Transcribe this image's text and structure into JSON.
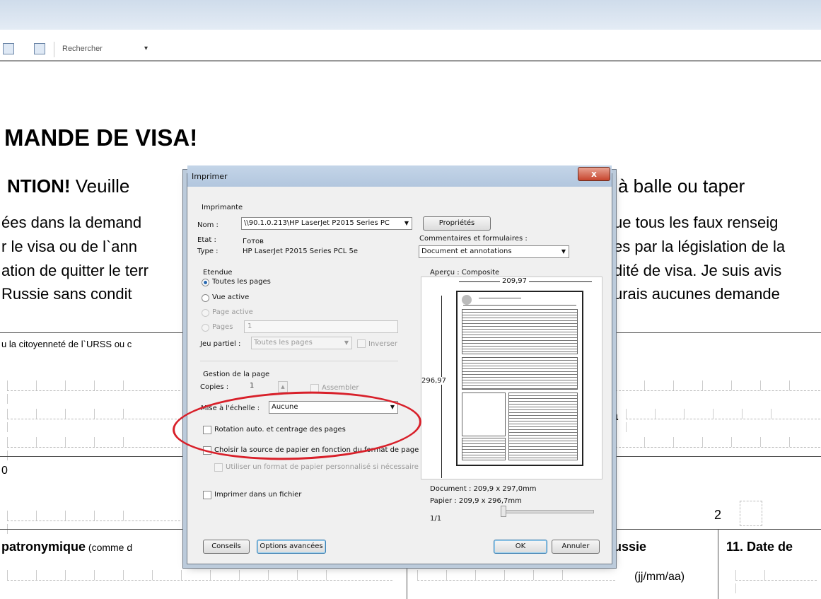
{
  "toolbar": {
    "search_label": "Rechercher"
  },
  "document": {
    "title": "MANDE DE VISA!",
    "attention_bold": "NTION!",
    "attention_rest": " Veuille",
    "attention_right": "à balle ou taper",
    "left_lines": [
      "ées dans la demand",
      "r le visa ou de l`ann",
      "ation de quitter le terr",
      " Russie sans condit"
    ],
    "right_lines": [
      "ue tous les faux renseig",
      "es par la législation de la",
      "dité de visa. Je suis avis",
      "urais aucunes demande"
    ],
    "citizenship": "u la citoyenneté de l`URSS ou c",
    "a_letter": "a",
    "num_zero": "0",
    "num_two": "2",
    "patronyme_bold": "patronymique",
    "patronyme_rest": " (comme d",
    "russie": "ussie",
    "date_header": "11. Date de",
    "date_format": "(jj/mm/aa)"
  },
  "dialog": {
    "title": "Imprimer",
    "printer_group": "Imprimante",
    "name_label": "Nom :",
    "name_value": "\\\\90.1.0.213\\HP LaserJet P2015 Series PC",
    "state_label": "Etat :",
    "state_value": "Готов",
    "type_label": "Type :",
    "type_value": "HP LaserJet P2015 Series PCL 5e",
    "properties_btn": "Propriétés",
    "comments_label": "Commentaires et formulaires :",
    "comments_value": "Document et annotations",
    "range_group": "Etendue",
    "range_all": "Toutes les pages",
    "range_current_view": "Vue active",
    "range_current_page": "Page active",
    "range_pages": "Pages",
    "range_pages_value": "1",
    "subset_label": "Jeu partiel :",
    "subset_value": "Toutes les pages",
    "reverse_label": "Inverser",
    "page_handling_group": "Gestion de la page",
    "copies_label": "Copies :",
    "copies_value": "1",
    "collate_label": "Assembler",
    "scaling_label": "Mise à l'échelle :",
    "scaling_value": "Aucune",
    "auto_rotate": "Rotation auto. et centrage des pages",
    "paper_source": "Choisir la source de papier en fonction du format de page",
    "custom_paper": "Utiliser un format de papier personnalisé si nécessaire",
    "print_to_file": "Imprimer dans un fichier",
    "preview_label": "Aperçu : Composite",
    "width_dim": "209,97",
    "height_dim": "296,97",
    "doc_size": "Document : 209,9 x 297,0mm",
    "paper_size": "Papier : 209,9 x 296,7mm",
    "page_count": "1/1",
    "tips_btn": "Conseils",
    "advanced_btn": "Options avancées",
    "ok_btn": "OK",
    "cancel_btn": "Annuler",
    "close_glyph": "x"
  },
  "colors": {
    "annotation_ellipse": "#d8202a",
    "dialog_frame": "#bccbdb"
  }
}
